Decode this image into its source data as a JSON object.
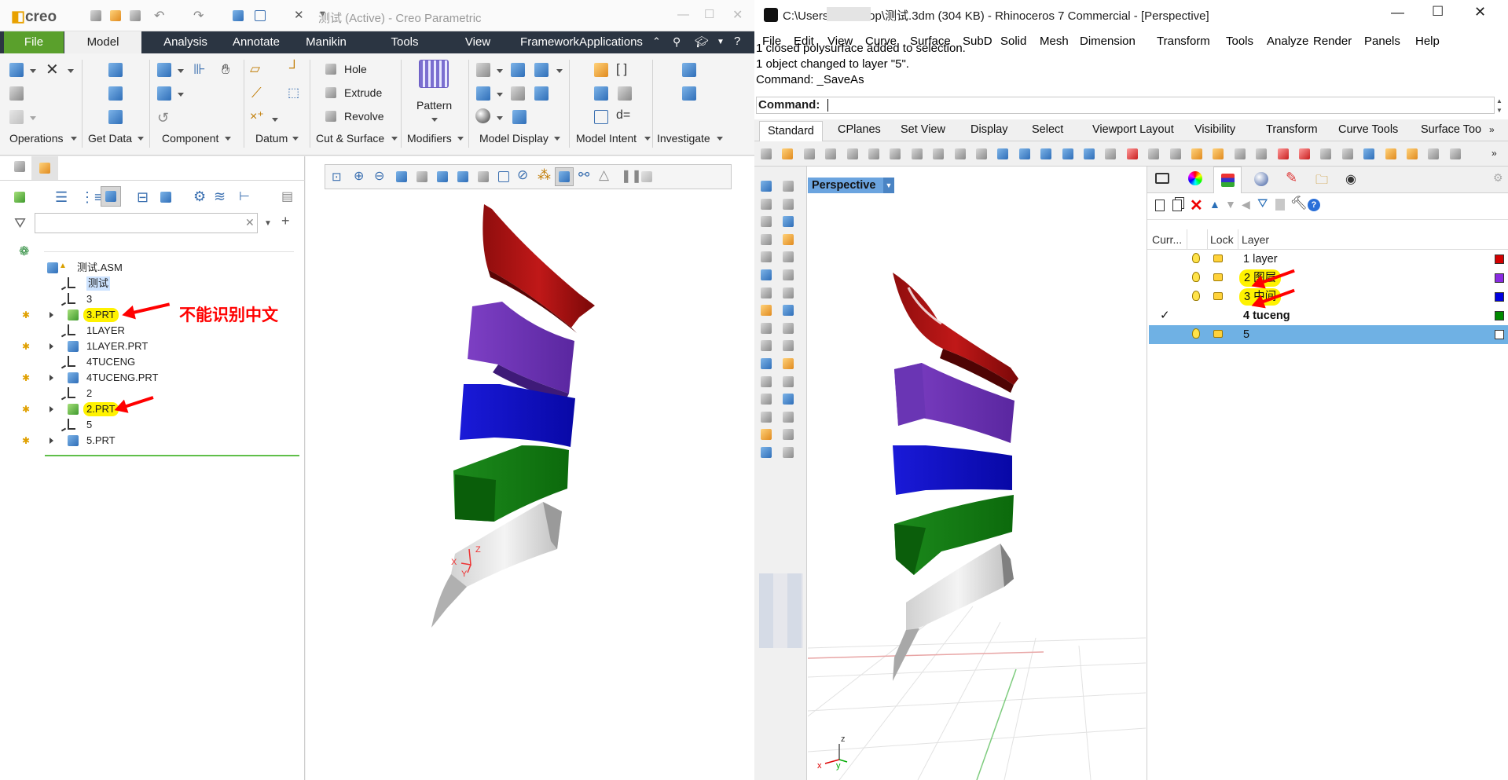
{
  "creo": {
    "logo": "creo",
    "title": "测试 (Active) - Creo Parametric",
    "tabs": [
      "File",
      "Model",
      "Analysis",
      "Annotate",
      "Manikin",
      "Tools",
      "View",
      "FrameworkApplications"
    ],
    "ribbon": {
      "hole": "Hole",
      "extrude": "Extrude",
      "revolve": "Revolve",
      "pattern": "Pattern",
      "groups": [
        "Operations",
        "Get Data",
        "Component",
        "Datum",
        "Cut & Surface",
        "Modifiers",
        "Model Display",
        "Model Intent",
        "Investigate"
      ]
    },
    "tree": [
      {
        "label": "测试.ASM",
        "kind": "asm",
        "star": false
      },
      {
        "label": "测试",
        "kind": "csys",
        "star": false
      },
      {
        "label": "3",
        "kind": "csys",
        "star": false
      },
      {
        "label": "3.PRT",
        "kind": "prt-green",
        "star": true
      },
      {
        "label": "1LAYER",
        "kind": "csys",
        "star": false
      },
      {
        "label": "1LAYER.PRT",
        "kind": "prt",
        "star": true
      },
      {
        "label": "4TUCENG",
        "kind": "csys",
        "star": false
      },
      {
        "label": "4TUCENG.PRT",
        "kind": "prt",
        "star": true
      },
      {
        "label": "2",
        "kind": "csys",
        "star": false
      },
      {
        "label": "2.PRT",
        "kind": "prt-green",
        "star": true
      },
      {
        "label": "5",
        "kind": "csys",
        "star": false
      },
      {
        "label": "5.PRT",
        "kind": "prt",
        "star": true
      }
    ],
    "annotation": "不能识别中文",
    "axes": {
      "z": "Z",
      "x": "X",
      "y": "Y"
    }
  },
  "rhino": {
    "title": "C:\\Users\\       \\Desktop\\测试.3dm (304 KB) - Rhinoceros 7 Commercial - [Perspective]",
    "menu": [
      "File",
      "Edit",
      "View",
      "Curve",
      "Surface",
      "SubD",
      "Solid",
      "Mesh",
      "Dimension",
      "Transform",
      "Tools",
      "Analyze",
      "Render",
      "Panels",
      "Help"
    ],
    "history": [
      "1 closed polysurface added to selection.",
      "1 object changed to layer \"5\".",
      "Command: _SaveAs"
    ],
    "command_label": "Command:",
    "toolbar_tabs": [
      "Standard",
      "CPlanes",
      "Set View",
      "Display",
      "Select",
      "Viewport Layout",
      "Visibility",
      "Transform",
      "Curve Tools",
      "Surface Too"
    ],
    "viewport": "Perspective",
    "layer_headers": {
      "current": "Curr...",
      "lock": "Lock",
      "layer": "Layer"
    },
    "layers": [
      {
        "name": "1 layer",
        "color": "#d40000",
        "current": false,
        "visible": true
      },
      {
        "name": "2 图层",
        "color": "#8a2be2",
        "current": false,
        "visible": true
      },
      {
        "name": "3 中间",
        "color": "#0000e0",
        "current": false,
        "visible": true
      },
      {
        "name": "4 tuceng",
        "color": "#008a00",
        "current": true,
        "visible": false
      },
      {
        "name": "5",
        "color": "#ffffff",
        "current": false,
        "visible": true
      }
    ],
    "axes": {
      "z": "z",
      "x": "x",
      "y": "y"
    }
  }
}
